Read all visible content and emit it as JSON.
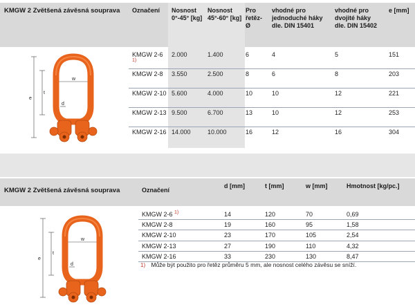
{
  "table1": {
    "title": "KMGW 2 Zvětšená závěsná souprava",
    "headers": {
      "designation": "Označení",
      "load1": "Nosnost 0°-45° [kg]",
      "load2": "Nosnost 45°-60° [kg]",
      "chain": "Pro řetěz- Ø",
      "single": "vhodné pro jednoduché háky dle. DIN 15401",
      "double": "vhodné pro dvojité háky dle. DIN 15402",
      "e": "e [mm]"
    },
    "rows": [
      {
        "designation": "KMGW 2-6",
        "sup": "1)",
        "load1": "2.000",
        "load2": "1.400",
        "chain": "6",
        "single": "4",
        "double": "5",
        "e": "151"
      },
      {
        "designation": "KMGW 2-8",
        "sup": "",
        "load1": "3.550",
        "load2": "2.500",
        "chain": "8",
        "single": "6",
        "double": "8",
        "e": "203"
      },
      {
        "designation": "KMGW 2-10",
        "sup": "",
        "load1": "5.600",
        "load2": "4.000",
        "chain": "10",
        "single": "10",
        "double": "12",
        "e": "221"
      },
      {
        "designation": "KMGW 2-13",
        "sup": "",
        "load1": "9.500",
        "load2": "6.700",
        "chain": "13",
        "single": "10",
        "double": "12",
        "e": "253"
      },
      {
        "designation": "KMGW 2-16",
        "sup": "",
        "load1": "14.000",
        "load2": "10.000",
        "chain": "16",
        "single": "12",
        "double": "16",
        "e": "304"
      }
    ],
    "diagram_labels": {
      "w": "w",
      "e": "e",
      "t": "t",
      "d": "d"
    }
  },
  "table2": {
    "title": "KMGW 2 Zvětšená závěsná souprava",
    "headers": {
      "designation": "Označení",
      "d": "d [mm]",
      "t": "t [mm]",
      "w": "w [mm]",
      "weight": "Hmotnost [kg/pc.]"
    },
    "rows": [
      {
        "designation": "KMGW 2-6",
        "sup": "1)",
        "d": "14",
        "t": "120",
        "w": "70",
        "weight": "0,69"
      },
      {
        "designation": "KMGW 2-8",
        "sup": "",
        "d": "19",
        "t": "160",
        "w": "95",
        "weight": "1,58"
      },
      {
        "designation": "KMGW 2-10",
        "sup": "",
        "d": "23",
        "t": "170",
        "w": "105",
        "weight": "2,54"
      },
      {
        "designation": "KMGW 2-13",
        "sup": "",
        "d": "27",
        "t": "190",
        "w": "110",
        "weight": "4,32"
      },
      {
        "designation": "KMGW 2-16",
        "sup": "",
        "d": "33",
        "t": "230",
        "w": "130",
        "weight": "8,47"
      }
    ],
    "footnote_mark": "1)",
    "footnote": "Může být použito pro řetěz průměru 5 mm, ale nosnost celého závěsu se sníží.",
    "diagram_labels": {
      "w": "w",
      "e": "e",
      "t": "t",
      "d": "d"
    }
  },
  "colors": {
    "orange": "#e8641c",
    "header_gray": "#d9d9d9",
    "shade_gray": "#e4e4e4",
    "row_line": "#9aa5b4",
    "footnote_red": "#c0392b"
  }
}
